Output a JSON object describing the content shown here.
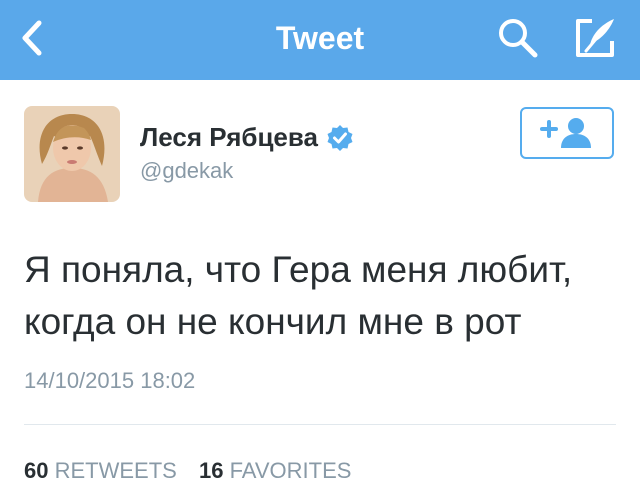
{
  "navbar": {
    "title": "Tweet",
    "back_icon": "chevron-left-icon",
    "search_icon": "search-icon",
    "compose_icon": "compose-tweet-icon",
    "background": "#5aa8ea"
  },
  "tweet": {
    "author": {
      "name": "Леся Рябцева",
      "handle": "@gdekak",
      "verified": true,
      "verified_icon": "verified-badge-icon"
    },
    "follow_icon": "add-user-icon",
    "text": "Я поняла, что Гера меня любит,\nкогда он не кончил мне в рот",
    "timestamp": "14/10/2015 18:02",
    "stats": {
      "retweets_count": "60",
      "retweets_label": "RETWEETS",
      "favorites_count": "16",
      "favorites_label": "FAVORITES"
    }
  },
  "colors": {
    "accent": "#55acee",
    "text": "#292f33",
    "muted": "#8899a6"
  }
}
